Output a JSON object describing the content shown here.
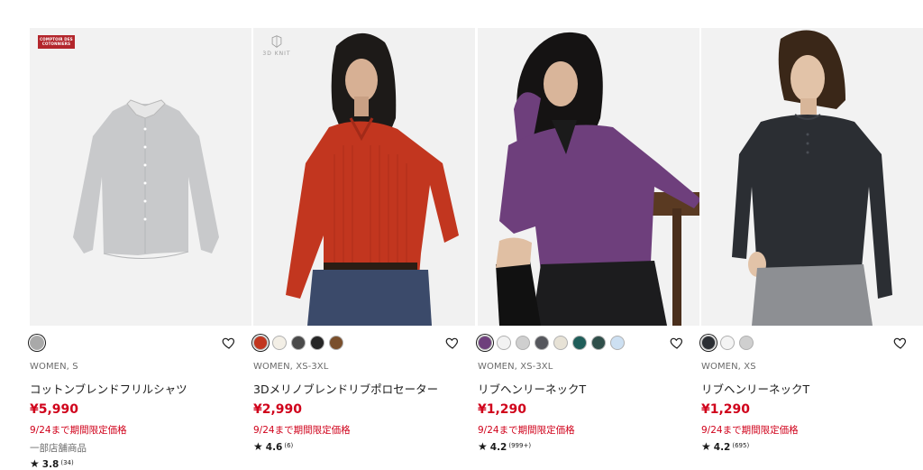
{
  "products": [
    {
      "badge": "COMPTOIR DES COTONNIERS",
      "swatches": [
        "#a9a9a9"
      ],
      "meta": "WOMEN, S",
      "name": "コットンブレンドフリルシャツ",
      "price": "¥5,990",
      "promo": "9/24まで期間限定価格",
      "store_note": "一部店舗商品",
      "rating": {
        "star": "★",
        "score": "3.8",
        "count": "(34)"
      }
    },
    {
      "badge": "3D KNIT",
      "swatches": [
        "#c2361f",
        "#f3efe6",
        "#4a4a4a",
        "#262626",
        "#7a4f2c"
      ],
      "meta": "WOMEN, XS-3XL",
      "name": "3Dメリノブレンドリブポロセーター",
      "price": "¥2,990",
      "promo": "9/24まで期間限定価格",
      "rating": {
        "star": "★",
        "score": "4.6",
        "count": "(6)"
      }
    },
    {
      "swatches": [
        "#6e3f7c",
        "#f2f2f2",
        "#cfcfcf",
        "#56575d",
        "#e7e2d6",
        "#1f5e5a",
        "#2f4f4a",
        "#cde0f2"
      ],
      "meta": "WOMEN, XS-3XL",
      "name": "リブヘンリーネックT",
      "price": "¥1,290",
      "promo": "9/24まで期間限定価格",
      "rating": {
        "star": "★",
        "score": "4.2",
        "count": "(999+)"
      }
    },
    {
      "swatches": [
        "#2b2e33",
        "#f4f4f4",
        "#cfcfcf"
      ],
      "meta": "WOMEN, XS",
      "name": "リブヘンリーネックT",
      "price": "¥1,290",
      "promo": "9/24まで期間限定価格",
      "rating": {
        "star": "★",
        "score": "4.2",
        "count": "(695)"
      }
    }
  ],
  "icons": {
    "favorite": "heart-outline-icon",
    "rating": "star-icon"
  },
  "colors": {
    "price_red": "#d0021b",
    "text": "#1b1b1b",
    "meta_gray": "#6b6b6b",
    "badge_red": "#b3262c"
  }
}
